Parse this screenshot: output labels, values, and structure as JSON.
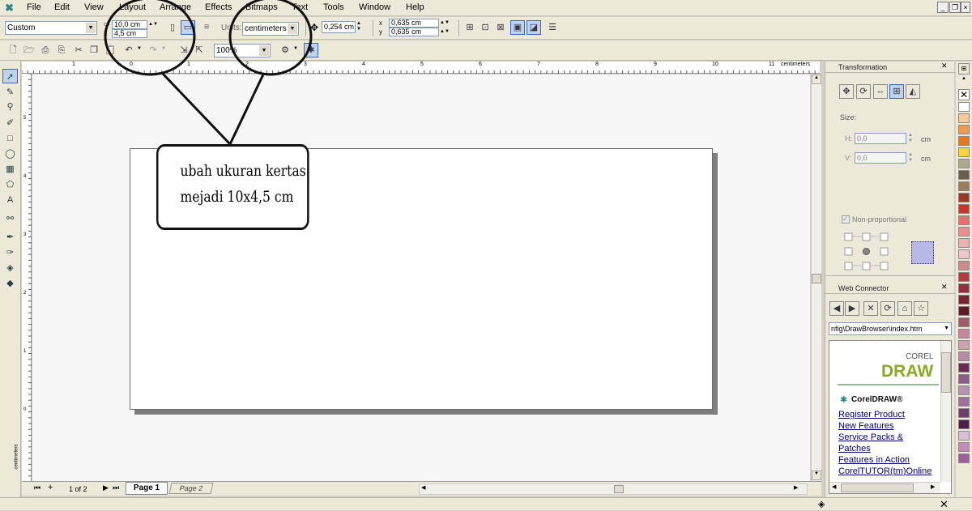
{
  "menu": [
    "File",
    "Edit",
    "View",
    "Layout",
    "Arrange",
    "Effects",
    "Bitmaps",
    "Text",
    "Tools",
    "Window",
    "Help"
  ],
  "property_bar": {
    "paper_type": "Custom",
    "width": "10,0 cm",
    "height": "4,5 cm",
    "units_label": "Units:",
    "units_value": "centimeters",
    "nudge": "0,254 cm",
    "dup_x": "0,635 cm",
    "dup_y": "0,635 cm",
    "x_label": "x",
    "y_label": "y"
  },
  "standard_bar": {
    "zoom": "100%"
  },
  "ruler": {
    "h_ticks": [
      "1",
      "0",
      "1",
      "2",
      "3",
      "4",
      "5",
      "6",
      "7",
      "8",
      "9",
      "10",
      "11"
    ],
    "h_unit": "centimeters",
    "v_ticks": [
      "5",
      "4",
      "3",
      "2",
      "1",
      "0"
    ],
    "v_unit": "centimeters"
  },
  "callout": {
    "line1": "ubah ukuran kertas",
    "line2": "mejadi 10x4,5 cm"
  },
  "page_nav": {
    "count": "1 of 2",
    "tab1": "Page 1",
    "tab2": "Page 2"
  },
  "transformation": {
    "title": "Transformation",
    "size_label": "Size:",
    "h_label": "H:",
    "h_value": "0,0",
    "v_label": "V:",
    "v_value": "0,0",
    "unit": "cm",
    "nonprop_label": "Non-proportional"
  },
  "web_connector": {
    "title": "Web Connector",
    "address": "nfig\\DrawBrowser\\index.htm",
    "brand_small": "COREL",
    "brand_big": "DRAW",
    "brand_line": "CorelDRAW®",
    "links": [
      "Register Product",
      "New Features",
      "Service Packs &",
      "Patches",
      "Features in Action",
      "CorelTUTOR(tm)Online"
    ]
  },
  "palette_colors": [
    "#ffffff",
    "#f6c89a",
    "#ed9a4f",
    "#e87722",
    "#f9d43a",
    "#b0a98b",
    "#6d5e4c",
    "#9e7d5b",
    "#9a3a24",
    "#c9342d",
    "#e56f6f",
    "#e89090",
    "#ebb0b0",
    "#efc7c7",
    "#cf8a8a",
    "#b23b3b",
    "#932d42",
    "#7b2230",
    "#5f1a25",
    "#a25a6a",
    "#c5859a",
    "#cfa2b2",
    "#b98aa5",
    "#6a2c56",
    "#8c5a86",
    "#b792b4",
    "#9d6f9a",
    "#6f3e6c",
    "#4b1f4a",
    "#d8bfd6",
    "#c18cb8",
    "#9e5f99"
  ]
}
